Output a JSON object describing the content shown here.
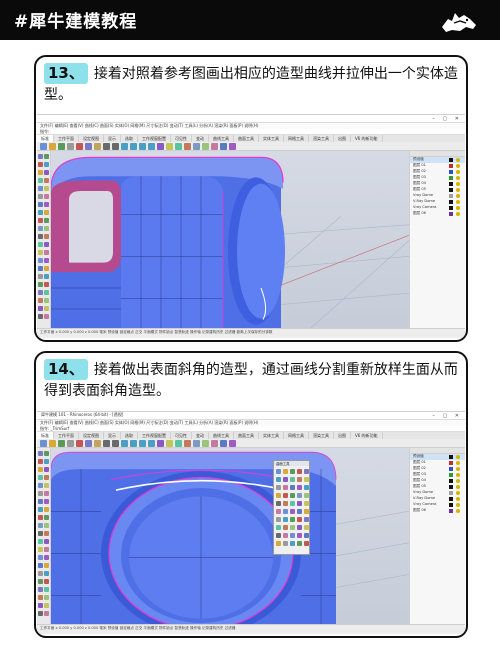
{
  "header": {
    "title": "#犀牛建模教程",
    "logo_icon": "rhino-logo-icon"
  },
  "steps": [
    {
      "number": "13、",
      "text": "接着对照着参考图画出相应的造型曲线并拉伸出一个实体造型。",
      "window_title": "",
      "menu": "文件(F) 编辑(E) 查看(V) 曲线(C) 曲面(S) 实体(O) 网格(M) 尺寸标注(D) 变动(T) 工具(L) 分析(A) 渲染(R) 面板(P) 说明(H)",
      "command": "指令:",
      "tabs": [
        "标准",
        "工作平面",
        "设定视图",
        "显示",
        "选取",
        "工作视窗配置",
        "可见性",
        "变动",
        "曲线工具",
        "曲面工具",
        "实体工具",
        "网格工具",
        "渲染工具",
        "出图",
        "V6 的新功能"
      ],
      "layers": [
        "预设值",
        "图层 01",
        "图层 02",
        "图层 03",
        "图层 04",
        "图层 05",
        "Vray Dome",
        "V-Ray Dome",
        "Vray Camera",
        "图层 06"
      ],
      "layer_colors": [
        "#111111",
        "#c03030",
        "#3050c0",
        "#2f9a2f",
        "#111111",
        "#111111",
        "#a0a0a0",
        "#111111",
        "#111111",
        "#7030a0"
      ],
      "status": "工作平面  x 0.000  y 0.000  z 0.000  毫米  预设值  锁定格点  正交  平面模式  物件锁点  智慧轨迹  操作轴  记录建构历史  过滤器  距离上次保存的分钟数"
    },
    {
      "number": "14、",
      "text": "接着做出表面斜角的造型，通过画线分割重新放样生面从而得到表面斜角造型。",
      "window_title": "犀牛建模 101 - Rhinoceros (64-bit) - [透视]",
      "menu": "文件(F) 编辑(E) 查看(V) 曲线(C) 曲面(S) 实体(O) 网格(M) 尺寸标注(D) 变动(T) 工具(L) 分析(A) 渲染(R) 面板(P) 说明(H)",
      "command": "指令: _TrimSurf",
      "tabs": [
        "标准",
        "工作平面",
        "设定视图",
        "显示",
        "选取",
        "工作视窗配置",
        "可见性",
        "变动",
        "曲线工具",
        "曲面工具",
        "实体工具",
        "网格工具",
        "渲染工具",
        "出图",
        "V6 的新功能"
      ],
      "layers": [
        "预设值",
        "图层 01",
        "图层 02",
        "图层 03",
        "图层 04",
        "图层 05",
        "Vray Dome",
        "V-Ray Dome",
        "Vray Camera",
        "图层 06"
      ],
      "layer_colors": [
        "#111111",
        "#c03030",
        "#3050c0",
        "#2f9a2f",
        "#111111",
        "#111111",
        "#a0a0a0",
        "#111111",
        "#111111",
        "#7030a0"
      ],
      "palette_title": "曲面工具",
      "status": "工作平面  x 0.000  y 0.000  z 0.000  毫米  预设值  锁定格点  正交  平面模式  物件锁点  智慧轨迹  操作轴  记录建构历史  过滤器"
    }
  ],
  "colors": {
    "step_badge": "#8ee0ea",
    "model_blue": "#4f6fe6",
    "edge_magenta": "#e23bd3"
  }
}
